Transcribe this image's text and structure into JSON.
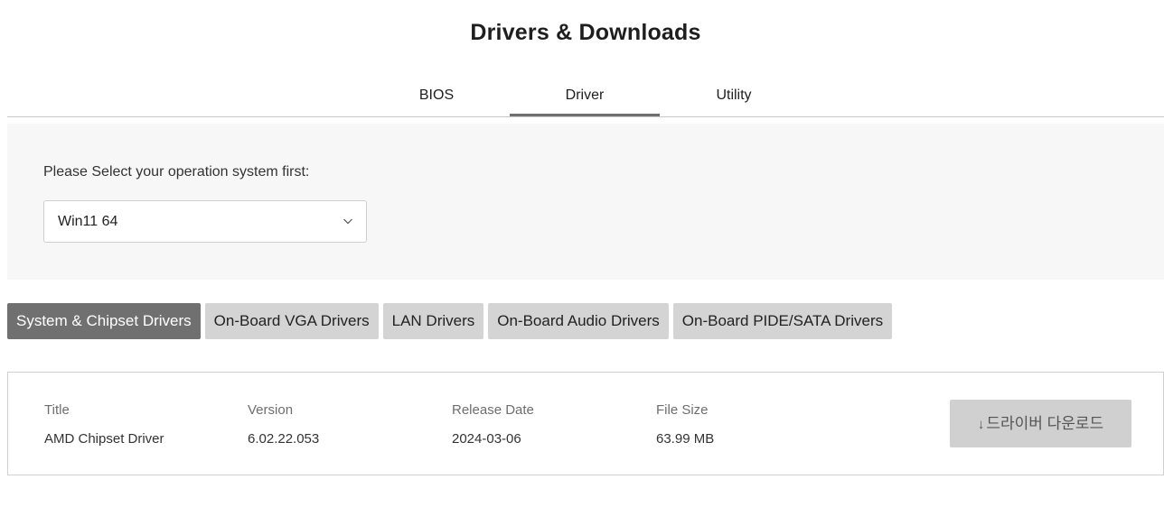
{
  "header": {
    "title": "Drivers & Downloads"
  },
  "tabs": [
    {
      "label": "BIOS",
      "active": false
    },
    {
      "label": "Driver",
      "active": true
    },
    {
      "label": "Utility",
      "active": false
    }
  ],
  "os_selector": {
    "label": "Please Select your operation system first:",
    "selected": "Win11 64"
  },
  "categories": [
    {
      "label": "System & Chipset Drivers",
      "active": true
    },
    {
      "label": "On-Board VGA Drivers",
      "active": false
    },
    {
      "label": "LAN Drivers",
      "active": false
    },
    {
      "label": "On-Board Audio Drivers",
      "active": false
    },
    {
      "label": "On-Board PIDE/SATA Drivers",
      "active": false
    }
  ],
  "driver_table": {
    "columns": [
      "Title",
      "Version",
      "Release Date",
      "File Size"
    ],
    "rows": [
      {
        "title": "AMD Chipset Driver",
        "version": "6.02.22.053",
        "release_date": "2024-03-06",
        "file_size": "63.99 MB",
        "download_label": "드라이버 다운로드",
        "download_icon": "↓"
      }
    ]
  },
  "colors": {
    "active_tab_underline": "#707070",
    "active_category": "#707070",
    "inactive_category": "#d4d4d4",
    "download_button": "#d0d0d0",
    "panel_background": "#f7f7f7"
  }
}
